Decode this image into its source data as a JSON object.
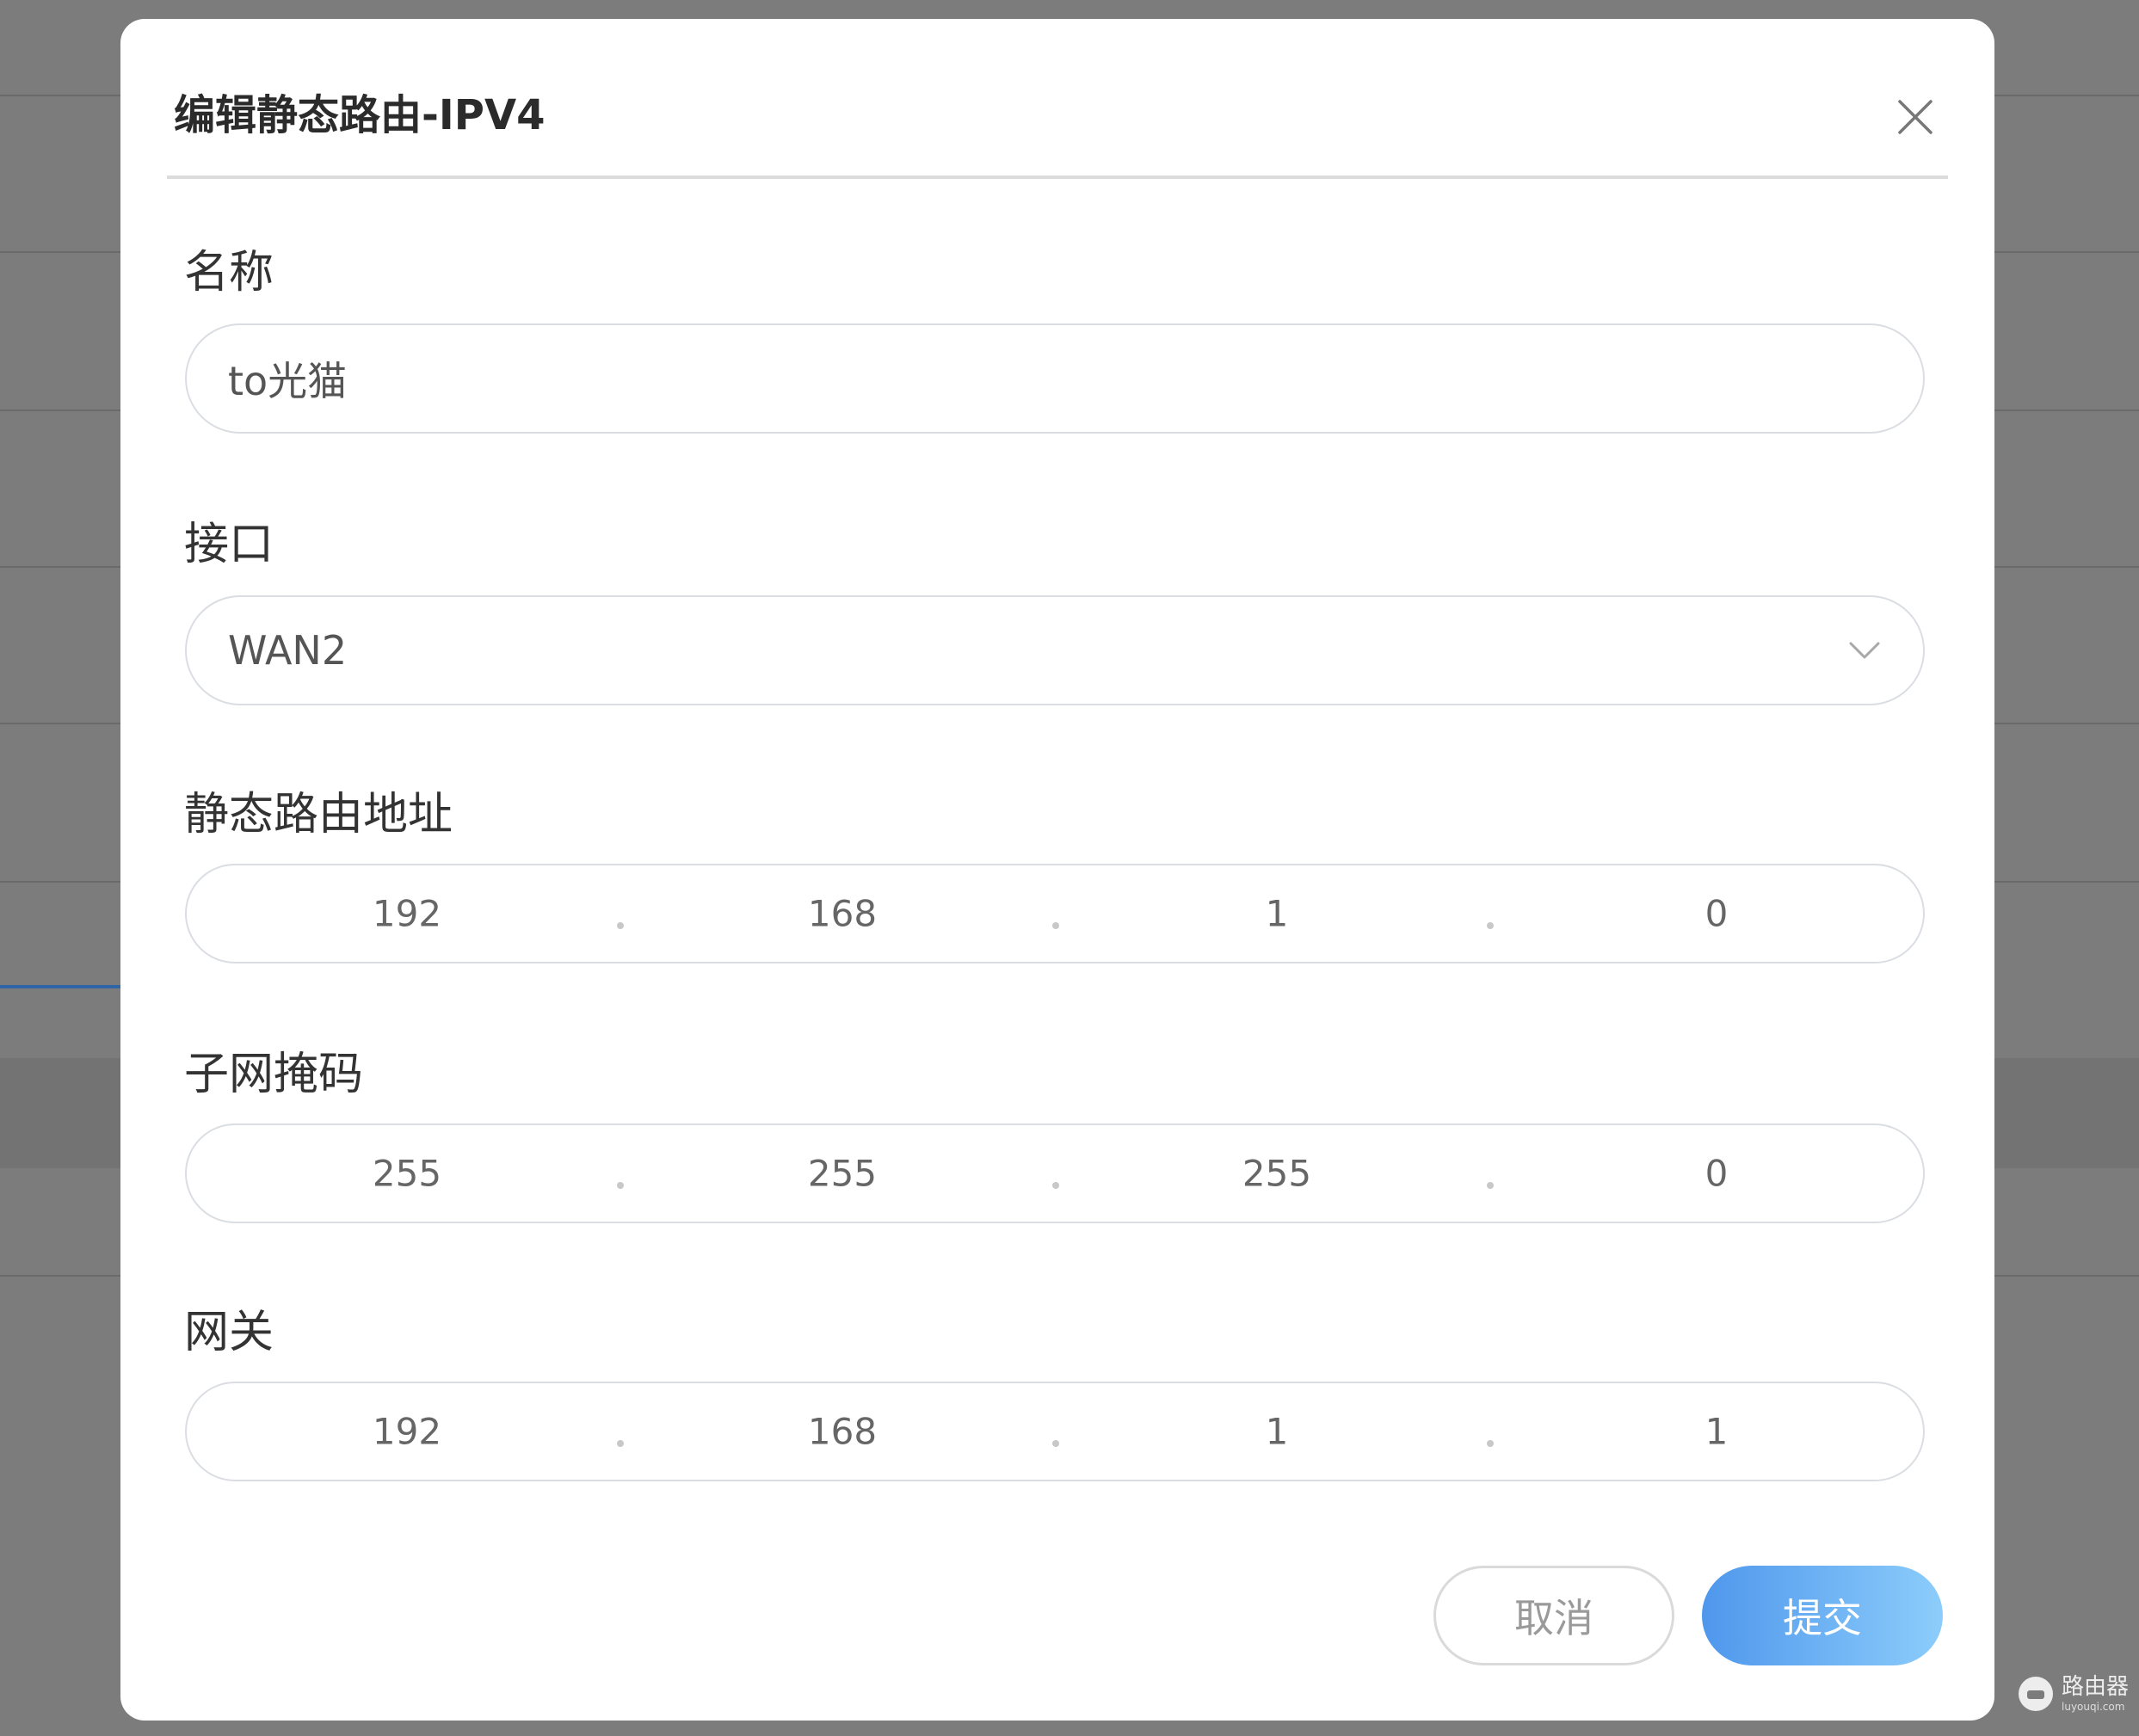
{
  "dialog": {
    "title": "编辑静态路由-IPV4"
  },
  "fields": {
    "name": {
      "label": "名称",
      "value": "to光猫"
    },
    "interface": {
      "label": "接口",
      "selected": "WAN2"
    },
    "route_address": {
      "label": "静态路由地址",
      "octets": [
        "192",
        "168",
        "1",
        "0"
      ]
    },
    "subnet_mask": {
      "label": "子网掩码",
      "octets": [
        "255",
        "255",
        "255",
        "0"
      ]
    },
    "gateway": {
      "label": "网关",
      "octets": [
        "192",
        "168",
        "1",
        "1"
      ]
    }
  },
  "actions": {
    "cancel_label": "取消",
    "submit_label": "提交"
  },
  "watermark": {
    "main": "路由器",
    "sub": "luyouqi.com"
  },
  "colors": {
    "submit_gradient_start": "#4f97ec",
    "submit_gradient_end": "#8ccdfb",
    "overlay": "#7c7c7c"
  }
}
